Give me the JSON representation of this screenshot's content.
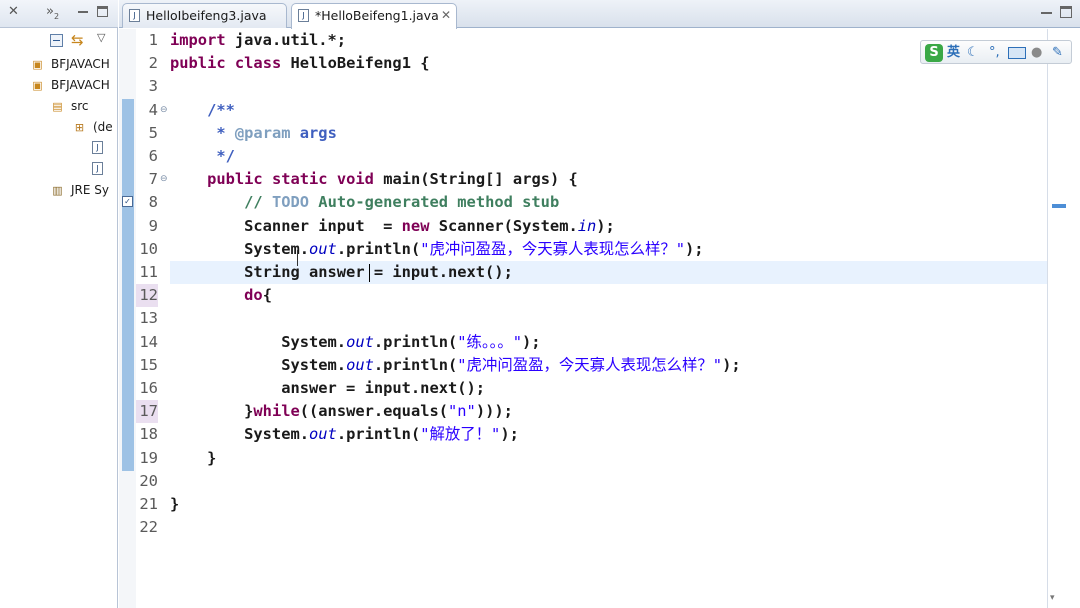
{
  "left_pane": {
    "view_tab_overflow": "»",
    "view_tab_overflow_count": "2",
    "tree": [
      {
        "label": "BFJAVACH",
        "icon": "project-icon",
        "indent": 0
      },
      {
        "label": "BFJAVACH",
        "icon": "project-icon",
        "indent": 0
      },
      {
        "label": "src",
        "icon": "source-folder-icon",
        "indent": 1
      },
      {
        "label": "(de",
        "icon": "package-icon",
        "indent": 2
      },
      {
        "label": "",
        "icon": "java-file-icon",
        "indent": 3
      },
      {
        "label": "",
        "icon": "java-file-icon",
        "indent": 3
      },
      {
        "label": "JRE Sy",
        "icon": "library-icon",
        "indent": 1
      }
    ]
  },
  "editor_tabs": [
    {
      "label": "HelloIbeifeng3.java",
      "active": false,
      "closable": false
    },
    {
      "label": "*HelloBeifeng1.java",
      "active": true,
      "closable": true
    }
  ],
  "ime_toolbar": {
    "logo": "S",
    "mode": "英",
    "items": [
      "moon-icon",
      "punctuation-icon",
      "keyboard-icon",
      "user-icon",
      "wrench-icon"
    ]
  },
  "editor": {
    "current_line": 11,
    "line_numbers": [
      "1",
      "2",
      "3",
      "4",
      "5",
      "6",
      "7",
      "8",
      "9",
      "10",
      "11",
      "12",
      "13",
      "14",
      "15",
      "16",
      "17",
      "18",
      "19",
      "20",
      "21",
      "22"
    ],
    "folding_lines": [
      4,
      7
    ],
    "highlighted_line_numbers": [
      12,
      17
    ],
    "task_marker_line": 8,
    "lines": [
      [
        {
          "t": "kw",
          "v": "import"
        },
        {
          "t": "plain",
          "v": " java.util.*;"
        }
      ],
      [
        {
          "t": "kw",
          "v": "public"
        },
        {
          "t": "plain",
          "v": " "
        },
        {
          "t": "kw",
          "v": "class"
        },
        {
          "t": "plain",
          "v": " HelloBeifeng1 {"
        }
      ],
      [],
      [
        {
          "t": "plain",
          "v": "    "
        },
        {
          "t": "jdoc",
          "v": "/**"
        }
      ],
      [
        {
          "t": "plain",
          "v": "     "
        },
        {
          "t": "jdoc",
          "v": "* "
        },
        {
          "t": "tag",
          "v": "@param"
        },
        {
          "t": "jdoc",
          "v": " args"
        }
      ],
      [
        {
          "t": "plain",
          "v": "     "
        },
        {
          "t": "jdoc",
          "v": "*/"
        }
      ],
      [
        {
          "t": "plain",
          "v": "    "
        },
        {
          "t": "kw",
          "v": "public"
        },
        {
          "t": "plain",
          "v": " "
        },
        {
          "t": "kw",
          "v": "static"
        },
        {
          "t": "plain",
          "v": " "
        },
        {
          "t": "kw",
          "v": "void"
        },
        {
          "t": "plain",
          "v": " main(String[] args) {"
        }
      ],
      [
        {
          "t": "plain",
          "v": "        "
        },
        {
          "t": "cmt",
          "v": "// "
        },
        {
          "t": "todo",
          "v": "TODO"
        },
        {
          "t": "cmt",
          "v": " Auto-generated method stub"
        }
      ],
      [
        {
          "t": "plain",
          "v": "        Scanner input  = "
        },
        {
          "t": "kw",
          "v": "new"
        },
        {
          "t": "plain",
          "v": " Scanner(System."
        },
        {
          "t": "field",
          "v": "in"
        },
        {
          "t": "plain",
          "v": ");"
        }
      ],
      [
        {
          "t": "plain",
          "v": "        System."
        },
        {
          "t": "field",
          "v": "out"
        },
        {
          "t": "plain",
          "v": ".println("
        },
        {
          "t": "str",
          "v": "\"虎冲问盈盈，今天寡人表现怎么样？\""
        },
        {
          "t": "plain",
          "v": ");"
        }
      ],
      [
        {
          "t": "plain",
          "v": "        String answer = input.next();"
        }
      ],
      [
        {
          "t": "plain",
          "v": "        "
        },
        {
          "t": "kw",
          "v": "do"
        },
        {
          "t": "plain",
          "v": "{"
        }
      ],
      [],
      [
        {
          "t": "plain",
          "v": "            System."
        },
        {
          "t": "field",
          "v": "out"
        },
        {
          "t": "plain",
          "v": ".println("
        },
        {
          "t": "str",
          "v": "\"练。。。\""
        },
        {
          "t": "plain",
          "v": ");"
        }
      ],
      [
        {
          "t": "plain",
          "v": "            System."
        },
        {
          "t": "field",
          "v": "out"
        },
        {
          "t": "plain",
          "v": ".println("
        },
        {
          "t": "str",
          "v": "\"虎冲问盈盈，今天寡人表现怎么样？\""
        },
        {
          "t": "plain",
          "v": ");"
        }
      ],
      [
        {
          "t": "plain",
          "v": "            answer = input.next();"
        }
      ],
      [
        {
          "t": "plain",
          "v": "        }"
        },
        {
          "t": "kw",
          "v": "while"
        },
        {
          "t": "plain",
          "v": "((answer.equals("
        },
        {
          "t": "str",
          "v": "\"n\""
        },
        {
          "t": "plain",
          "v": ")));"
        }
      ],
      [
        {
          "t": "plain",
          "v": "        System."
        },
        {
          "t": "field",
          "v": "out"
        },
        {
          "t": "plain",
          "v": ".println("
        },
        {
          "t": "str",
          "v": "\"解放了！\""
        },
        {
          "t": "plain",
          "v": ");"
        }
      ],
      [
        {
          "t": "plain",
          "v": "    }"
        }
      ],
      [],
      [
        {
          "t": "plain",
          "v": "}"
        }
      ],
      []
    ]
  },
  "colors": {
    "keyword": "#7f0055",
    "javadoc": "#3f5fbf",
    "comment": "#3f7f5f",
    "string": "#2a00ff",
    "field": "#0000c0",
    "current_line": "#e8f2fe",
    "ruler_band": "#9ec2e5"
  }
}
